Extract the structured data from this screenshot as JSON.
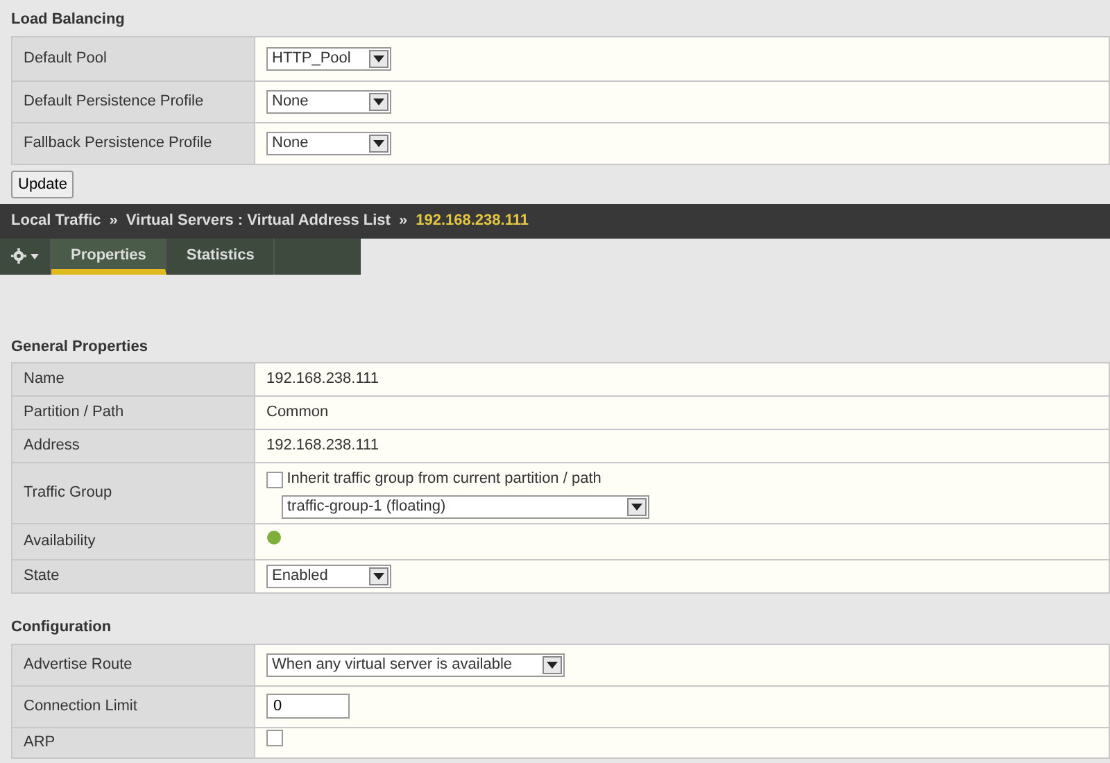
{
  "load_balancing": {
    "title": "Load Balancing",
    "rows": [
      {
        "label": "Default Pool",
        "kind": "select",
        "value": "HTTP_Pool"
      },
      {
        "label": "Default Persistence Profile",
        "kind": "select",
        "value": "None"
      },
      {
        "label": "Fallback Persistence Profile",
        "kind": "select",
        "value": "None"
      }
    ]
  },
  "update_button": "Update",
  "breadcrumb": {
    "separator": "»",
    "items": [
      "Local Traffic",
      "Virtual Servers : Virtual Address List",
      "192.168.238.111"
    ]
  },
  "tabs": [
    {
      "label": "Properties",
      "selected": true
    },
    {
      "label": "Statistics",
      "selected": false
    }
  ],
  "general_properties": {
    "title": "General Properties",
    "rows": [
      {
        "label": "Name",
        "kind": "text",
        "value": "192.168.238.111"
      },
      {
        "label": "Partition / Path",
        "kind": "text",
        "value": "Common"
      },
      {
        "label": "Address",
        "kind": "text",
        "value": "192.168.238.111"
      },
      {
        "label": "Traffic Group",
        "kind": "traffic_group",
        "checkbox_label": "Inherit traffic group from current partition / path",
        "checked": false,
        "value": "traffic-group-1 (floating)"
      },
      {
        "label": "Availability",
        "kind": "status"
      },
      {
        "label": "State",
        "kind": "select",
        "value": "Enabled"
      }
    ]
  },
  "configuration": {
    "title": "Configuration",
    "rows": [
      {
        "label": "Advertise Route",
        "kind": "select",
        "value": "When any virtual server is available"
      },
      {
        "label": "Connection Limit",
        "kind": "input",
        "value": "0"
      },
      {
        "label": "ARP",
        "kind": "checkbox",
        "checked": false
      }
    ]
  }
}
